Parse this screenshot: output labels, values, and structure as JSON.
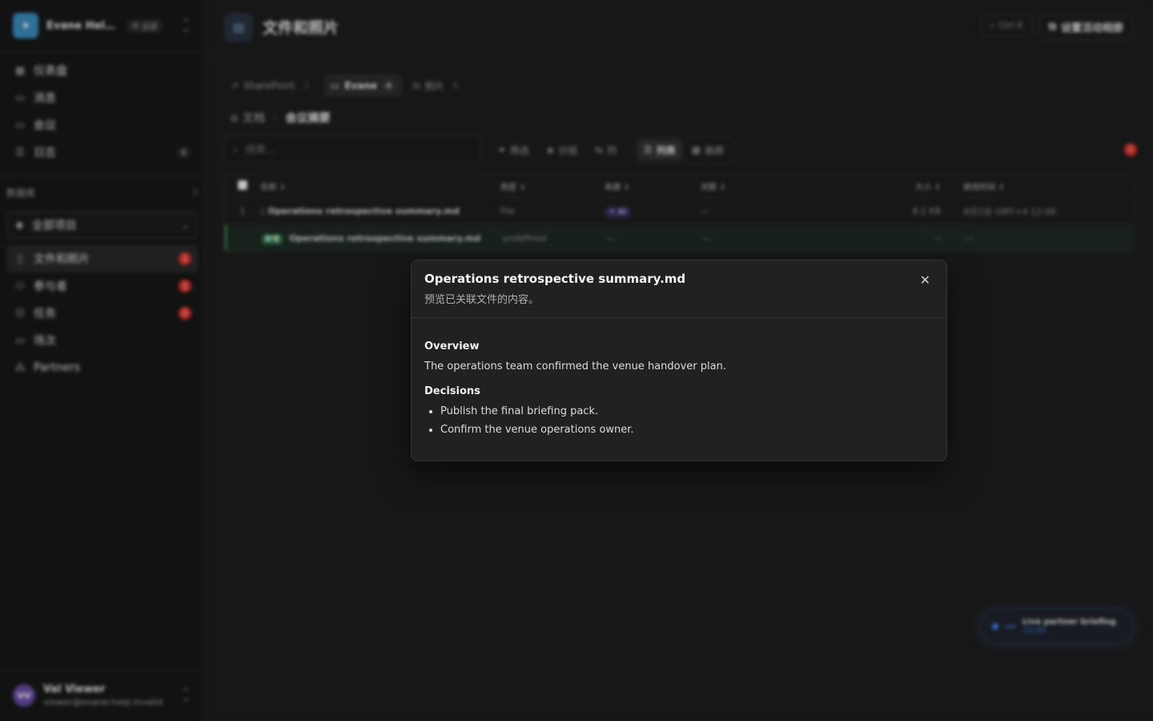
{
  "workspace": {
    "name": "Evane Help ...",
    "badge": "全球",
    "logo_icon": "sparkles-icon"
  },
  "nav_primary": [
    {
      "label": "仪表盘",
      "icon": "grid-icon",
      "count": ""
    },
    {
      "label": "消息",
      "icon": "message-icon",
      "count": ""
    },
    {
      "label": "会议",
      "icon": "video-icon",
      "count": ""
    },
    {
      "label": "日志",
      "icon": "log-icon",
      "count": "6"
    }
  ],
  "database": {
    "title": "数据库",
    "scope": "全部项目",
    "items": [
      {
        "label": "文件和照片",
        "icon": "file-icon",
        "badge": "1",
        "active": true
      },
      {
        "label": "参与者",
        "icon": "users-icon",
        "badge": "1"
      },
      {
        "label": "任务",
        "icon": "checklist-icon",
        "badge": "2"
      },
      {
        "label": "场次",
        "icon": "presentation-icon",
        "badge": ""
      },
      {
        "label": "Partners",
        "icon": "partners-icon",
        "badge": ""
      }
    ]
  },
  "user": {
    "initials": "VV",
    "name": "Val Viewer",
    "email": "viewer@evane-help.invalid"
  },
  "header": {
    "title": "文件和照片",
    "shortcut": "Ctrl K",
    "album_button": "设置活动相册"
  },
  "source_tabs": [
    {
      "label": "SharePoint",
      "count": "1"
    },
    {
      "label": "Evane",
      "count": "4"
    },
    {
      "label": "照片",
      "count": "0"
    }
  ],
  "breadcrumb": {
    "root": "文档",
    "current": "会议摘要"
  },
  "toolbar": {
    "search_placeholder": "搜索...",
    "filter": "筛选",
    "group": "分组",
    "columns": "列",
    "view_list": "列表",
    "view_gallery": "画廊",
    "alert_count": "1"
  },
  "table": {
    "columns": [
      "名称",
      "类型",
      "来源",
      "关联",
      "大小",
      "修改时间"
    ],
    "rows": [
      {
        "index": "1",
        "name": "Operations retrospective summary.md",
        "type": "File",
        "source": "AI",
        "related": "—",
        "size": "8.2 KB",
        "modified": "9月1日 GMT+4 12:00"
      },
      {
        "new_tag": "新增",
        "name": "Operations retrospective summary.md",
        "type": "undefined",
        "source": "—",
        "related": "—",
        "size": "—",
        "modified": "—"
      }
    ]
  },
  "live_pill": {
    "title": "Live partner briefing",
    "time": "15:00"
  },
  "modal": {
    "title": "Operations retrospective summary.md",
    "subtitle": "预览已关联文件的内容。",
    "sections": [
      {
        "heading": "Overview",
        "text": "The operations team confirmed the venue handover plan."
      },
      {
        "heading": "Decisions",
        "bullets": [
          "Publish the final briefing pack.",
          "Confirm the venue operations owner."
        ]
      }
    ]
  },
  "colors": {
    "accent_blue": "#3b82f6",
    "badge_red": "#e3342f",
    "new_green": "#3fae6a",
    "logo_blue": "#3a8fc0",
    "avatar_purple": "#6a4ca8"
  }
}
